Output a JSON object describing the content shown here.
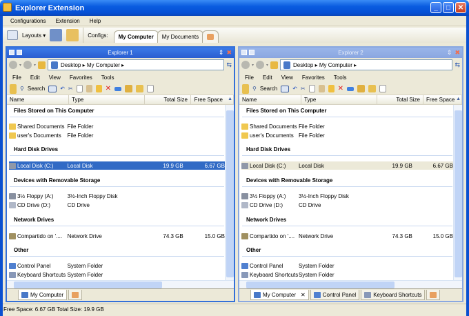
{
  "window": {
    "title": "Explorer Extension",
    "min": "_",
    "max": "□",
    "close": "✕"
  },
  "menu": [
    "Configurations",
    "Extension",
    "Help"
  ],
  "toolbar": {
    "layouts": "Layouts ▾",
    "configs_label": "Configs:",
    "configs": [
      "My Computer",
      "My Documents"
    ]
  },
  "columns": [
    "Name",
    "Type",
    "Total Size",
    "Free Space"
  ],
  "groups": [
    "Files Stored on This Computer",
    "Hard Disk Drives",
    "Devices with Removable Storage",
    "Network Drives",
    "Other"
  ],
  "panel_menu": [
    "File",
    "Edit",
    "View",
    "Favorites",
    "Tools"
  ],
  "search_label": "Search",
  "address": "Desktop ▸ My Computer ▸",
  "items": [
    {
      "name": "Shared Documents",
      "type": "File Folder",
      "total": "",
      "free": "",
      "color": "#f0c850"
    },
    {
      "name": "user's Documents",
      "type": "File Folder",
      "total": "",
      "free": "",
      "color": "#f0c850"
    },
    {
      "name": "Local Disk (C:)",
      "type": "Local Disk",
      "total": "19.9 GB",
      "free": "6.67 GB",
      "color": "#9098a8"
    },
    {
      "name": "3½ Floppy (A:)",
      "type": "3½-Inch Floppy Disk",
      "total": "",
      "free": "",
      "color": "#8890a0"
    },
    {
      "name": "CD Drive (D:)",
      "type": "CD Drive",
      "total": "",
      "free": "",
      "color": "#b0b8c8"
    },
    {
      "name": "Compartido on '....",
      "type": "Network Drive",
      "total": "74.3 GB",
      "free": "15.0 GB",
      "color": "#a09060"
    },
    {
      "name": "Control Panel",
      "type": "System Folder",
      "total": "",
      "free": "",
      "color": "#5080d0"
    },
    {
      "name": "Keyboard Shortcuts",
      "type": "System Folder",
      "total": "",
      "free": "",
      "color": "#8898b8"
    }
  ],
  "panels": [
    {
      "title": "Explorer 1",
      "selected_item": 2,
      "tabs": [
        "My Computer"
      ]
    },
    {
      "title": "Explorer 2",
      "selected_item": -1,
      "tabs": [
        "My Computer",
        "Control Panel",
        "Keyboard Shortcuts"
      ]
    }
  ],
  "status": "Free Space: 6.67 GB Total Size: 19.9 GB"
}
